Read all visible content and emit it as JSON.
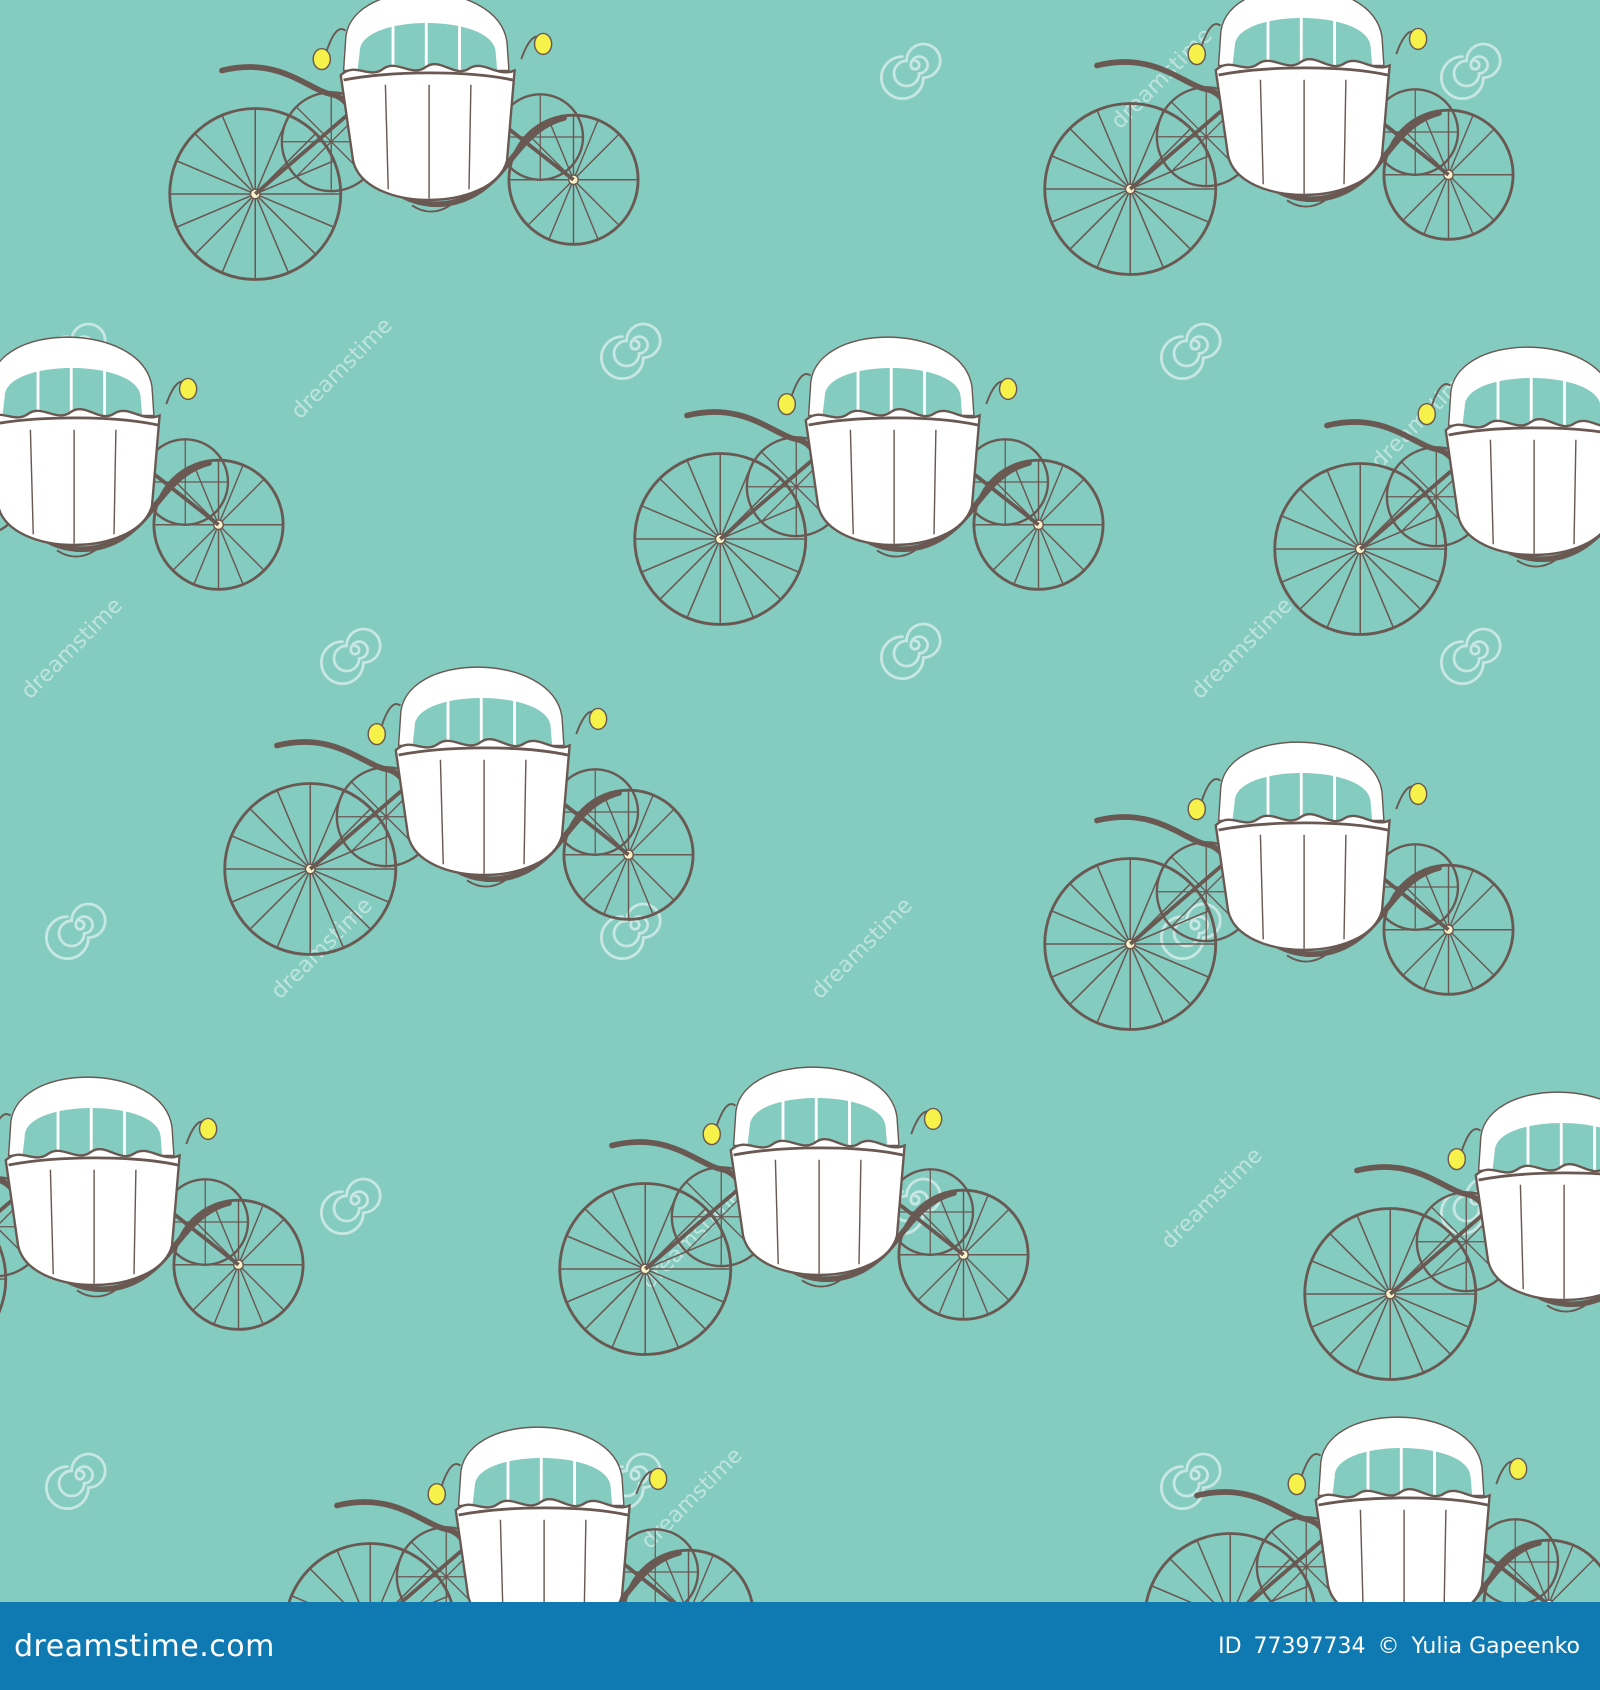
{
  "image": {
    "subject": "seamless pattern of carriages",
    "colors": {
      "background": "#84cbc0",
      "carriage_body": "#ffffff",
      "frame": "#6a5852",
      "lantern": "#f6f24a",
      "watermark": "#d9efeb",
      "footer_bg": "#0f79b2",
      "footer_text": "#ffffff"
    },
    "icons": [
      "carriage-icon",
      "lantern-icon",
      "spiral-watermark-icon"
    ]
  },
  "footer": {
    "site": "dreamstime.com",
    "id_label": "ID",
    "id_value": "77397734",
    "copyright_symbol": "©",
    "author": "Yulia Gapeenko"
  },
  "watermarks": {
    "text": "dreamstime"
  }
}
